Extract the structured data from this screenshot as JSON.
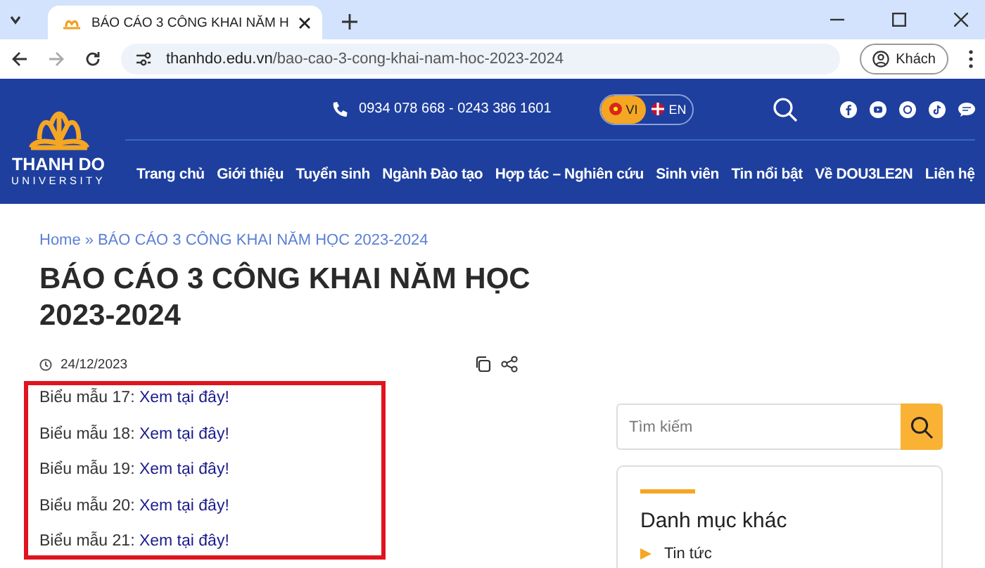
{
  "browser": {
    "tabs": [
      {
        "title": "BÁO CÁO 3 CÔNG KHAI NĂM H",
        "selected": true
      }
    ],
    "url_host": "thanhdo.edu.vn",
    "url_path": "/bao-cao-3-cong-khai-nam-hoc-2023-2024",
    "profile": "Khách"
  },
  "header": {
    "logo": {
      "name": "THANH DO",
      "subtitle": "UNIVERSITY"
    },
    "phone": "0934 078 668 - 0243 386 1601",
    "languages": [
      {
        "label": "VI",
        "selected": true
      },
      {
        "label": "EN",
        "selected": false
      }
    ],
    "nav": [
      "Trang chủ",
      "Giới thiệu",
      "Tuyển sinh",
      "Ngành Đào tạo",
      "Hợp tác – Nghiên cứu",
      "Sinh viên",
      "Tin nổi bật",
      "Về DOU3LE2N",
      "Liên hệ"
    ]
  },
  "breadcrumb": {
    "items": [
      "Home",
      "BÁO CÁO 3 CÔNG KHAI NĂM HỌC 2023-2024"
    ],
    "separator": "»"
  },
  "article": {
    "title": "BÁO CÁO 3 CÔNG KHAI NĂM HỌC 2023-2024",
    "date": "24/12/2023",
    "forms": [
      {
        "label": "Biểu mẫu 17:",
        "link": "Xem tại đây!"
      },
      {
        "label": "Biểu mẫu 18:",
        "link": "Xem tại đây!"
      },
      {
        "label": "Biểu mẫu 19:",
        "link": "Xem tại đây!"
      },
      {
        "label": "Biểu mẫu 20:",
        "link": "Xem tại đây!"
      },
      {
        "label": "Biểu mẫu 21:",
        "link": "Xem tại đây!"
      }
    ]
  },
  "sidebar": {
    "search": {
      "placeholder": "Tìm kiếm"
    },
    "categories": {
      "title": "Danh mục khác",
      "items": [
        "Tin tức"
      ]
    }
  }
}
